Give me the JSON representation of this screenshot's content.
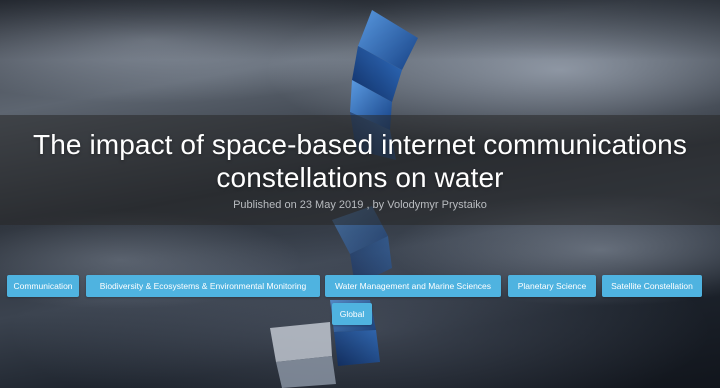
{
  "article": {
    "title_line1": "The impact of space-based internet communications",
    "title_line2": "constellations on water",
    "published_prefix": "Published on",
    "published_date": "23 May 2019",
    "author_prefix": ", by",
    "author": "Volodymyr Prystaiko"
  },
  "tags": [
    "Communication",
    "Biodiversity & Ecosystems & Environmental Monitoring",
    "Water Management and Marine Sciences",
    "Planetary Science",
    "Satellite Constellation",
    "Global"
  ],
  "colors": {
    "tag_background": "#4fb3e0",
    "title_text": "#ffffff",
    "satellite_blue": "#1f5fae"
  },
  "icons": {
    "hero_image": "earth-orbit-satellite-illustration"
  }
}
